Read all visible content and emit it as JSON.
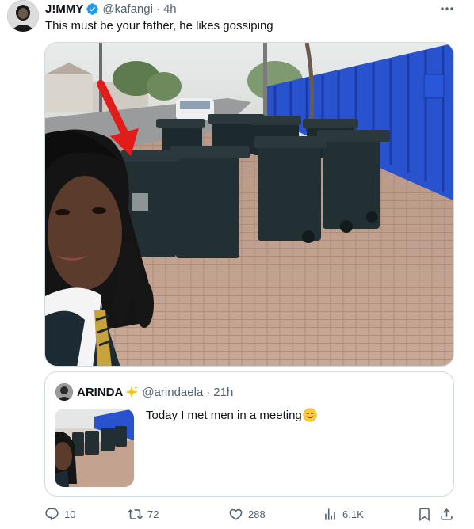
{
  "tweet": {
    "author_name": "J!MMY",
    "handle": "@kafangi",
    "separator": "·",
    "time": "4h",
    "text": "This must be your father, he likes gossiping",
    "verified_icon": "verified-badge-icon",
    "more_icon": "more-icon"
  },
  "quote": {
    "author_name": "ARINDA",
    "handle": "@arindaela",
    "separator": "·",
    "time": "21h",
    "text": "Today I met men in a meeting",
    "emoji": "smiling-face-emoji",
    "name_emoji": "sparkles-emoji"
  },
  "actions": {
    "reply_count": "10",
    "retweet_count": "72",
    "like_count": "288",
    "views_count": "6.1K"
  },
  "colors": {
    "text_primary": "#0f1419",
    "text_secondary": "#536471",
    "border": "#cfd9de",
    "verified": "#1d9bf0",
    "fence": "#1f4fd6",
    "arrow": "#e31b1b"
  }
}
